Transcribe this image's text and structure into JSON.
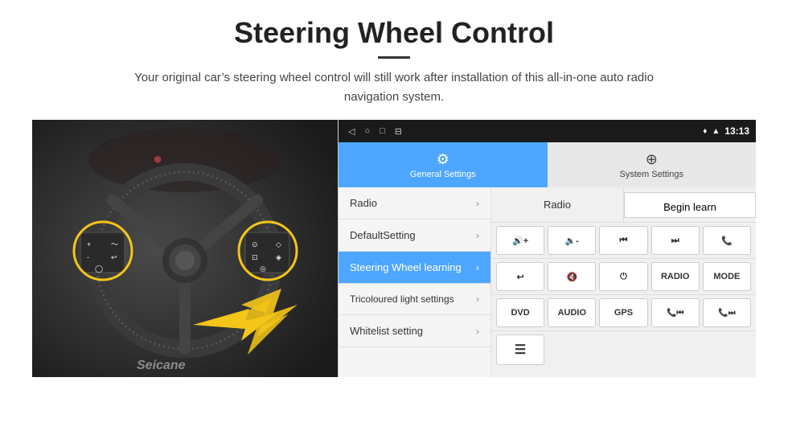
{
  "page": {
    "title": "Steering Wheel Control",
    "subtitle": "Your original car’s steering wheel control will still work after installation of this all-in-one auto radio navigation system."
  },
  "statusbar": {
    "time": "13:13",
    "nav_icons": [
      "◁",
      "○",
      "□",
      "⊟"
    ]
  },
  "tabs": [
    {
      "id": "general",
      "label": "General Settings",
      "active": true,
      "icon": "⚙"
    },
    {
      "id": "system",
      "label": "System Settings",
      "active": false,
      "icon": "⊕"
    }
  ],
  "menu": [
    {
      "id": "radio",
      "label": "Radio",
      "active": false
    },
    {
      "id": "default",
      "label": "DefaultSetting",
      "active": false
    },
    {
      "id": "steering",
      "label": "Steering Wheel learning",
      "active": true
    },
    {
      "id": "tricoloured",
      "label": "Tricoloured light settings",
      "active": false
    },
    {
      "id": "whitelist",
      "label": "Whitelist setting",
      "active": false
    }
  ],
  "panel": {
    "radio_label": "Radio",
    "begin_learn": "Begin learn",
    "buttons_row1": [
      {
        "label": "🔇+",
        "id": "vol-up"
      },
      {
        "label": "🔇-",
        "id": "vol-down"
      },
      {
        "label": "⏮",
        "id": "prev-track"
      },
      {
        "label": "⏭",
        "id": "next-track"
      },
      {
        "label": "📞",
        "id": "call"
      }
    ],
    "buttons_row2": [
      {
        "label": "↩",
        "id": "back"
      },
      {
        "label": "🔇×",
        "id": "mute"
      },
      {
        "label": "⏻",
        "id": "power"
      },
      {
        "label": "RADIO",
        "id": "radio-btn"
      },
      {
        "label": "MODE",
        "id": "mode"
      }
    ],
    "buttons_row3": [
      {
        "label": "DVD",
        "id": "dvd"
      },
      {
        "label": "AUDIO",
        "id": "audio"
      },
      {
        "label": "GPS",
        "id": "gps"
      },
      {
        "label": "📞⏮",
        "id": "call-prev"
      },
      {
        "label": "📞⏭",
        "id": "call-next"
      }
    ],
    "buttons_row4": [
      {
        "label": "☰",
        "id": "menu-btn"
      }
    ]
  },
  "watermark": "Seicane"
}
